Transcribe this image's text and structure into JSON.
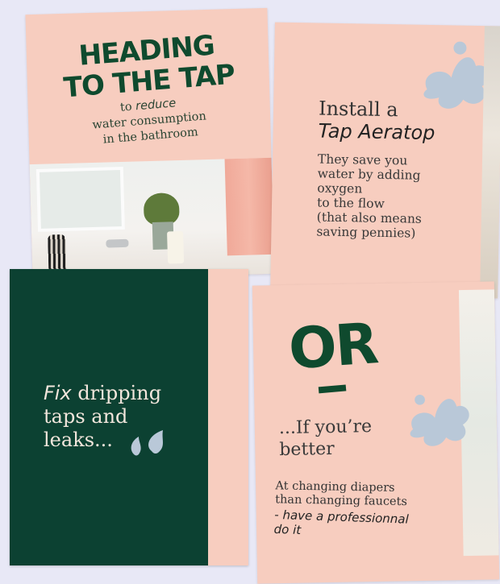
{
  "card1": {
    "heading_line1": "HEADING",
    "heading_line2": "TO THE TAP",
    "sub_prefix": "to ",
    "sub_italic": "reduce",
    "sub_line2": "water consumption",
    "sub_line3": "in the bathroom"
  },
  "card2": {
    "title_line1": "Install a",
    "title_line2": "Tap Aeratop",
    "body": "They save you\nwater by adding\noxygen\nto the flow\n(that also means\nsaving pennies)"
  },
  "card3": {
    "italic": "Fix",
    "text": " dripping\ntaps and\nleaks..."
  },
  "card4": {
    "big": "OR",
    "line1": "...If you’re\nbetter",
    "line2": "At changing diapers\nthan changing faucets",
    "line3": "- have a professionnal\ndo it"
  },
  "colors": {
    "background": "#e8e8f6",
    "card_pink": "#f7cdbf",
    "dark_green": "#0c4132",
    "accent_blue": "#b9c8d8"
  }
}
